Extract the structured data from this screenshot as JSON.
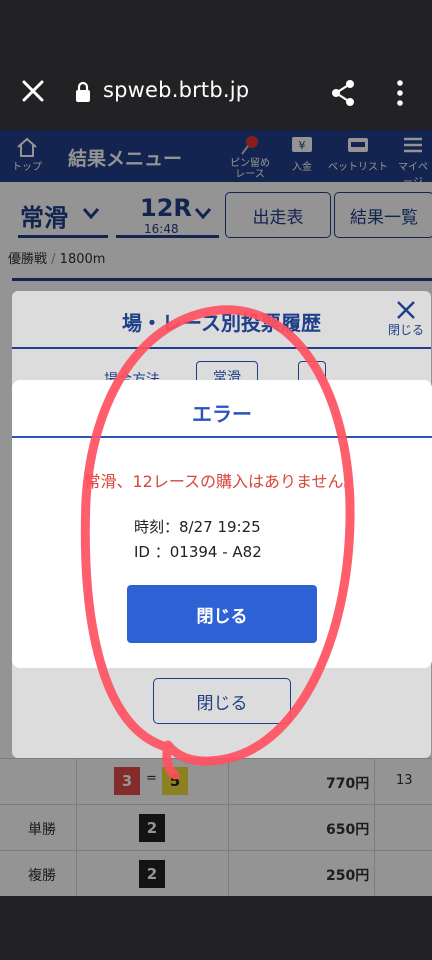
{
  "browser": {
    "url": "spweb.brtb.jp"
  },
  "menu": {
    "home_label": "トップ",
    "title": "結果メニュー",
    "items": [
      {
        "label": "ピン留め\nレース",
        "icon": "pin-icon"
      },
      {
        "label": "入金",
        "icon": "yen-icon"
      },
      {
        "label": "ベットリスト",
        "icon": "betlist-icon"
      },
      {
        "label": "マイページ",
        "icon": "menu-icon"
      }
    ]
  },
  "race": {
    "venue": "常滑",
    "race_no": "12R",
    "time": "16:48",
    "btn_entries": "出走表",
    "btn_results": "結果一覧",
    "race_name": "優勝戦",
    "distance": "1800m"
  },
  "history_modal": {
    "title": "場・レース別投票履歴",
    "close_label": "閉じる",
    "sub_label": "場合方法",
    "sub_value": "常滑",
    "close_button": "閉じる"
  },
  "error_dialog": {
    "title": "エラー",
    "message": "常滑、12レースの購入はありません。",
    "time_label": "時刻：",
    "time_value": "8/27 19:25",
    "id_label": "ID ：",
    "id_value": "01394 - A82",
    "close_button": "閉じる"
  },
  "results": [
    {
      "label": "",
      "nums": [
        "3",
        "5"
      ],
      "sep": "=",
      "amount": "770円",
      "popularity": "13"
    },
    {
      "label": "単勝",
      "nums": [
        "2"
      ],
      "amount": "650円",
      "popularity": ""
    },
    {
      "label": "複勝",
      "nums": [
        "2"
      ],
      "amount": "250円",
      "popularity": ""
    }
  ],
  "colors": {
    "brand": "#1f3f88",
    "error": "#d8463c",
    "primary_button": "#2e62d4",
    "annotation": "#ff5060"
  }
}
